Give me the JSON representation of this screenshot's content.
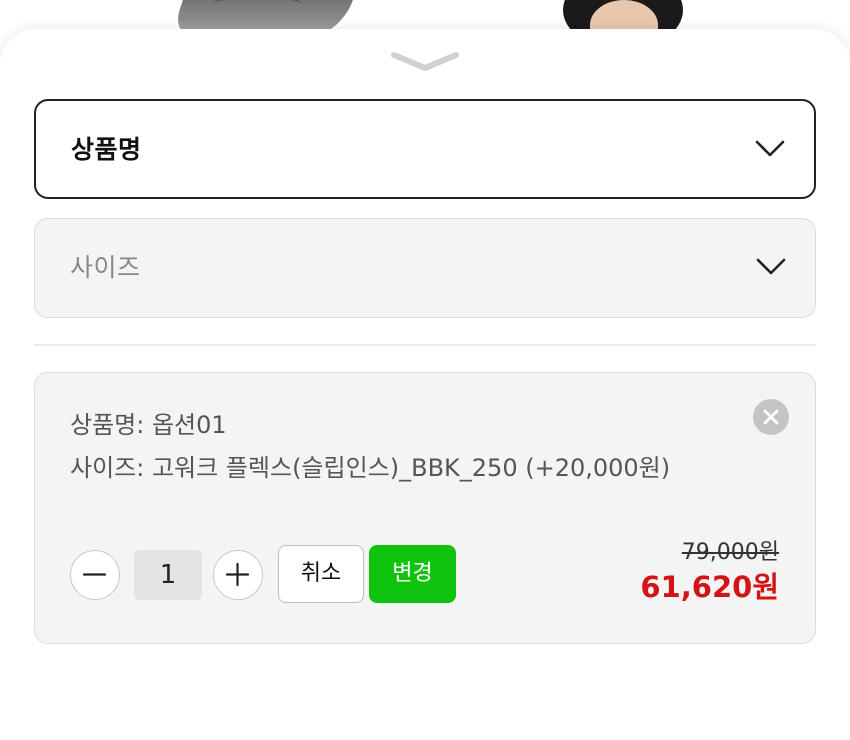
{
  "background": {
    "image_1": "shoe-image",
    "image_2": "model-photo"
  },
  "sheet": {
    "handle_icon": "chevron-down-icon"
  },
  "selects": {
    "product": {
      "label": "상품명",
      "icon": "chevron-down-icon"
    },
    "size": {
      "label": "사이즈",
      "icon": "chevron-down-icon"
    }
  },
  "selected_option": {
    "line_1": "상품명: 옵션01",
    "line_2": "사이즈: 고워크 플렉스(슬립인스)_BBK_250 (+20,000원)",
    "remove_icon": "close-circle-icon",
    "quantity": "1",
    "minus_icon": "minus-icon",
    "plus_icon": "plus-icon",
    "cancel_label": "취소",
    "change_label": "변경",
    "original_price": "79,000원",
    "sale_price": "61,620원"
  },
  "colors": {
    "accent_green": "#10c30f",
    "sale_red": "#d31315",
    "border_dark": "#222222",
    "card_bg": "#f4f4f4"
  }
}
